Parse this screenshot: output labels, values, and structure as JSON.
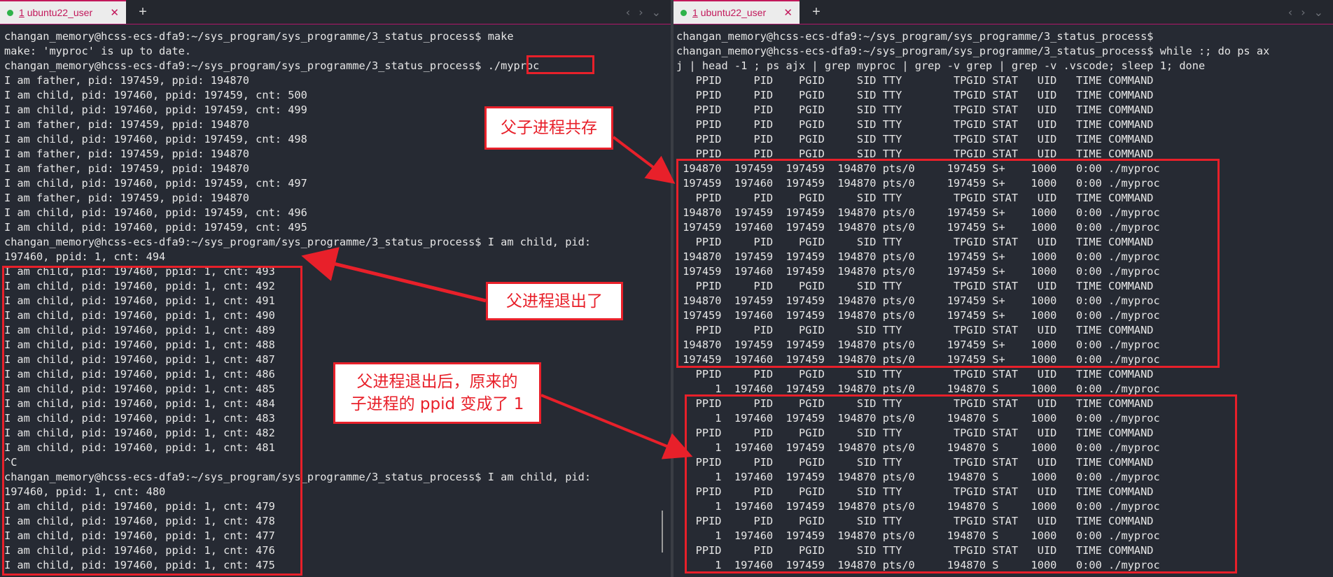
{
  "left_pane": {
    "tab": {
      "num": "1",
      "title": "ubuntu22_user",
      "close": "✕"
    },
    "new_tab": "+",
    "nav_prev": "‹",
    "nav_next": "›",
    "nav_menu": "⌄",
    "lines": [
      "changan_memory@hcss-ecs-dfa9:~/sys_program/sys_programme/3_status_process$ make",
      "make: 'myproc' is up to date.",
      "changan_memory@hcss-ecs-dfa9:~/sys_program/sys_programme/3_status_process$ ./myproc",
      "I am father, pid: 197459, ppid: 194870",
      "I am child, pid: 197460, ppid: 197459, cnt: 500",
      "I am child, pid: 197460, ppid: 197459, cnt: 499",
      "I am father, pid: 197459, ppid: 194870",
      "I am child, pid: 197460, ppid: 197459, cnt: 498",
      "I am father, pid: 197459, ppid: 194870",
      "I am father, pid: 197459, ppid: 194870",
      "I am child, pid: 197460, ppid: 197459, cnt: 497",
      "I am father, pid: 197459, ppid: 194870",
      "I am child, pid: 197460, ppid: 197459, cnt: 496",
      "I am child, pid: 197460, ppid: 197459, cnt: 495",
      "changan_memory@hcss-ecs-dfa9:~/sys_program/sys_programme/3_status_process$ I am child, pid:",
      "197460, ppid: 1, cnt: 494",
      "I am child, pid: 197460, ppid: 1, cnt: 493",
      "I am child, pid: 197460, ppid: 1, cnt: 492",
      "I am child, pid: 197460, ppid: 1, cnt: 491",
      "I am child, pid: 197460, ppid: 1, cnt: 490",
      "I am child, pid: 197460, ppid: 1, cnt: 489",
      "I am child, pid: 197460, ppid: 1, cnt: 488",
      "I am child, pid: 197460, ppid: 1, cnt: 487",
      "I am child, pid: 197460, ppid: 1, cnt: 486",
      "I am child, pid: 197460, ppid: 1, cnt: 485",
      "I am child, pid: 197460, ppid: 1, cnt: 484",
      "I am child, pid: 197460, ppid: 1, cnt: 483",
      "I am child, pid: 197460, ppid: 1, cnt: 482",
      "I am child, pid: 197460, ppid: 1, cnt: 481",
      "^C",
      "changan_memory@hcss-ecs-dfa9:~/sys_program/sys_programme/3_status_process$ I am child, pid:",
      "197460, ppid: 1, cnt: 480",
      "I am child, pid: 197460, ppid: 1, cnt: 479",
      "I am child, pid: 197460, ppid: 1, cnt: 478",
      "I am child, pid: 197460, ppid: 1, cnt: 477",
      "I am child, pid: 197460, ppid: 1, cnt: 476",
      "I am child, pid: 197460, ppid: 1, cnt: 475"
    ]
  },
  "right_pane": {
    "tab": {
      "num": "1",
      "title": "ubuntu22_user",
      "close": "✕"
    },
    "new_tab": "+",
    "nav_prev": "‹",
    "nav_next": "›",
    "nav_menu": "⌄",
    "lines": [
      "changan_memory@hcss-ecs-dfa9:~/sys_program/sys_programme/3_status_process$",
      "changan_memory@hcss-ecs-dfa9:~/sys_program/sys_programme/3_status_process$ while :; do ps ax",
      "j | head -1 ; ps ajx | grep myproc | grep -v grep | grep -v .vscode; sleep 1; done",
      "   PPID     PID    PGID     SID TTY        TPGID STAT   UID   TIME COMMAND",
      "   PPID     PID    PGID     SID TTY        TPGID STAT   UID   TIME COMMAND",
      "   PPID     PID    PGID     SID TTY        TPGID STAT   UID   TIME COMMAND",
      "   PPID     PID    PGID     SID TTY        TPGID STAT   UID   TIME COMMAND",
      "   PPID     PID    PGID     SID TTY        TPGID STAT   UID   TIME COMMAND",
      "   PPID     PID    PGID     SID TTY        TPGID STAT   UID   TIME COMMAND",
      " 194870  197459  197459  194870 pts/0     197459 S+    1000   0:00 ./myproc",
      " 197459  197460  197459  194870 pts/0     197459 S+    1000   0:00 ./myproc",
      "   PPID     PID    PGID     SID TTY        TPGID STAT   UID   TIME COMMAND",
      " 194870  197459  197459  194870 pts/0     197459 S+    1000   0:00 ./myproc",
      " 197459  197460  197459  194870 pts/0     197459 S+    1000   0:00 ./myproc",
      "   PPID     PID    PGID     SID TTY        TPGID STAT   UID   TIME COMMAND",
      " 194870  197459  197459  194870 pts/0     197459 S+    1000   0:00 ./myproc",
      " 197459  197460  197459  194870 pts/0     197459 S+    1000   0:00 ./myproc",
      "   PPID     PID    PGID     SID TTY        TPGID STAT   UID   TIME COMMAND",
      " 194870  197459  197459  194870 pts/0     197459 S+    1000   0:00 ./myproc",
      " 197459  197460  197459  194870 pts/0     197459 S+    1000   0:00 ./myproc",
      "   PPID     PID    PGID     SID TTY        TPGID STAT   UID   TIME COMMAND",
      " 194870  197459  197459  194870 pts/0     197459 S+    1000   0:00 ./myproc",
      " 197459  197460  197459  194870 pts/0     197459 S+    1000   0:00 ./myproc",
      "   PPID     PID    PGID     SID TTY        TPGID STAT   UID   TIME COMMAND",
      "      1  197460  197459  194870 pts/0     194870 S     1000   0:00 ./myproc",
      "   PPID     PID    PGID     SID TTY        TPGID STAT   UID   TIME COMMAND",
      "      1  197460  197459  194870 pts/0     194870 S     1000   0:00 ./myproc",
      "   PPID     PID    PGID     SID TTY        TPGID STAT   UID   TIME COMMAND",
      "      1  197460  197459  194870 pts/0     194870 S     1000   0:00 ./myproc",
      "   PPID     PID    PGID     SID TTY        TPGID STAT   UID   TIME COMMAND",
      "      1  197460  197459  194870 pts/0     194870 S     1000   0:00 ./myproc",
      "   PPID     PID    PGID     SID TTY        TPGID STAT   UID   TIME COMMAND",
      "      1  197460  197459  194870 pts/0     194870 S     1000   0:00 ./myproc",
      "   PPID     PID    PGID     SID TTY        TPGID STAT   UID   TIME COMMAND",
      "      1  197460  197459  194870 pts/0     194870 S     1000   0:00 ./myproc",
      "   PPID     PID    PGID     SID TTY        TPGID STAT   UID   TIME COMMAND",
      "      1  197460  197459  194870 pts/0     194870 S     1000   0:00 ./myproc"
    ]
  },
  "annotations": {
    "coexist": "父子进程共存",
    "parent_exit": "父进程退出了",
    "ppid_change_1": "父进程退出后，原来的",
    "ppid_change_2": "子进程的 ppid 变成了 1"
  },
  "colors": {
    "annotation_red": "#e8202a",
    "tab_accent": "#c2185b",
    "terminal_bg": "#262a33",
    "terminal_fg": "#e6e6e6",
    "tab_dot": "#2eb34a"
  }
}
